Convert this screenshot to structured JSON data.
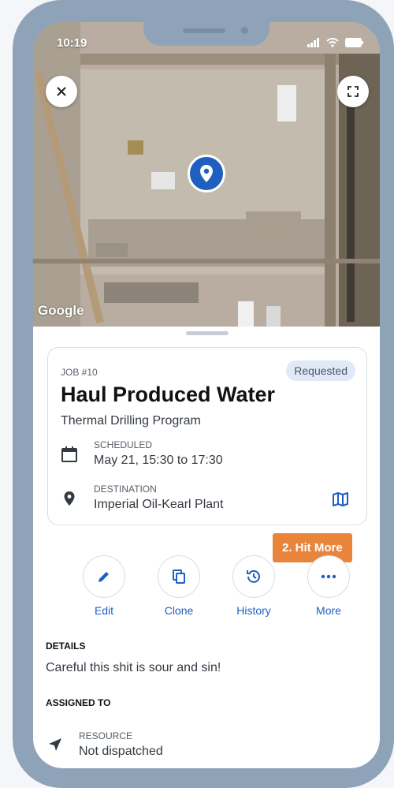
{
  "status_bar": {
    "time": "10:19"
  },
  "map": {
    "attribution": "Google",
    "close_icon": "close-icon",
    "expand_icon": "expand-icon",
    "pin_icon": "location-pin-icon"
  },
  "job": {
    "number": "JOB #10",
    "status": "Requested",
    "title": "Haul Produced Water",
    "program": "Thermal Drilling Program",
    "scheduled_label": "SCHEDULED",
    "scheduled_value": "May 21, 15:30 to 17:30",
    "destination_label": "DESTINATION",
    "destination_value": "Imperial Oil-Kearl Plant"
  },
  "hint": {
    "text": "2. Hit More"
  },
  "actions": [
    {
      "label": "Edit",
      "icon": "pencil-icon"
    },
    {
      "label": "Clone",
      "icon": "copy-icon"
    },
    {
      "label": "History",
      "icon": "history-icon"
    },
    {
      "label": "More",
      "icon": "more-icon"
    }
  ],
  "details": {
    "heading": "DETAILS",
    "text": "Careful this shit is sour and sin!"
  },
  "assigned": {
    "heading": "ASSIGNED TO",
    "resource_label": "RESOURCE",
    "resource_value": "Not dispatched"
  },
  "colors": {
    "accent": "#1f5fbf",
    "hint": "#e8853a",
    "frame": "#8fa3b8",
    "pill_bg": "#dfe9f7"
  }
}
